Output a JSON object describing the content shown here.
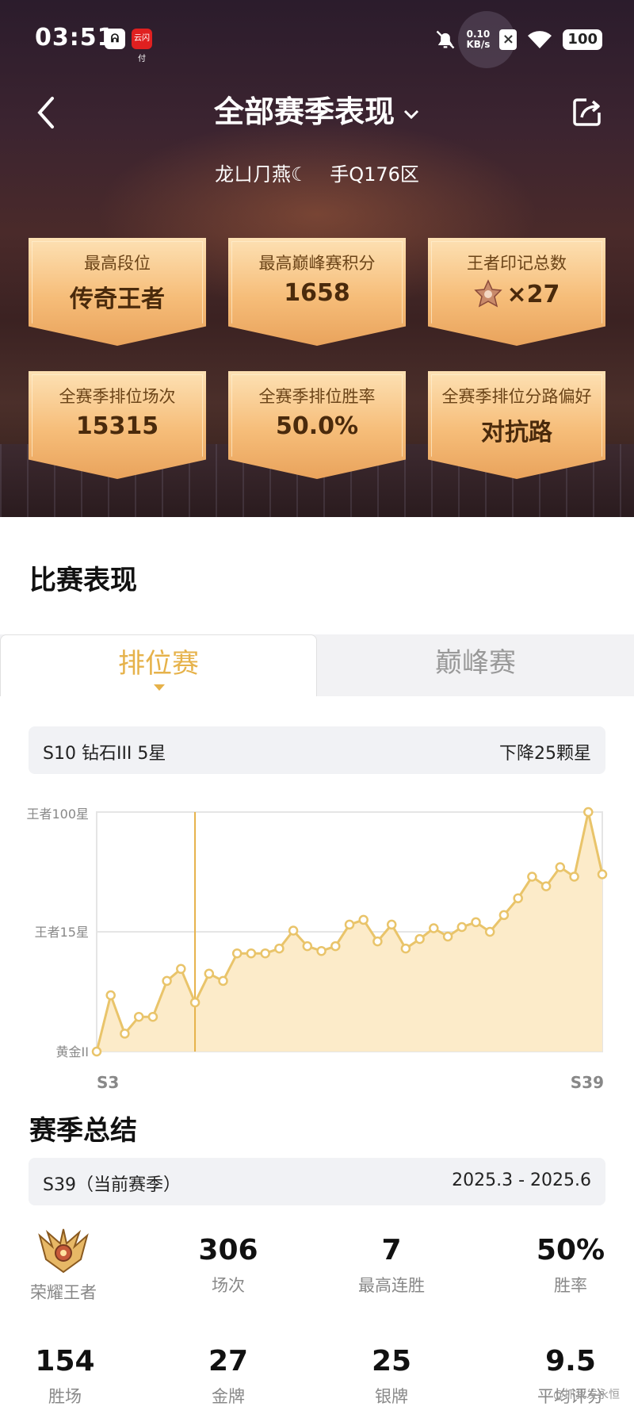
{
  "status_bar": {
    "time": "03:51",
    "pay_icon_text": "云闪付",
    "net_speed_value": "0.10",
    "net_speed_unit": "KB/s",
    "battery": "100"
  },
  "header": {
    "title": "全部赛季表现",
    "player_name": "龙ㄩ⺆燕☾",
    "server": "手Q176区"
  },
  "cards": [
    {
      "label": "最高段位",
      "value": "传奇王者"
    },
    {
      "label": "最高巅峰赛积分",
      "value": "1658"
    },
    {
      "label": "王者印记总数",
      "value": "×27"
    },
    {
      "label": "全赛季排位场次",
      "value": "15315"
    },
    {
      "label": "全赛季排位胜率",
      "value": "50.0%"
    },
    {
      "label": "全赛季排位分路偏好",
      "value": "对抗路"
    }
  ],
  "match_section": {
    "title": "比赛表现",
    "tabs": [
      {
        "label": "排位赛",
        "active": true
      },
      {
        "label": "巅峰赛",
        "active": false
      }
    ],
    "selected_info": {
      "left": "S10 钻石III 5星",
      "right": "下降25颗星"
    }
  },
  "chart_data": {
    "type": "area",
    "y_tick_labels": [
      "王者100星",
      "王者15星",
      "黄金II"
    ],
    "x_start_label": "S3",
    "x_end_label": "S39",
    "highlight_season_index": 7,
    "y_scale_note": "0 = 黄金II, 0.5 = 王者15星, 1 = 王者100星",
    "values": [
      0.0,
      0.235,
      0.075,
      0.145,
      0.145,
      0.295,
      0.345,
      0.205,
      0.325,
      0.295,
      0.41,
      0.41,
      0.41,
      0.43,
      0.505,
      0.44,
      0.42,
      0.44,
      0.53,
      0.55,
      0.46,
      0.53,
      0.43,
      0.47,
      0.515,
      0.48,
      0.52,
      0.54,
      0.5,
      0.57,
      0.64,
      0.73,
      0.69,
      0.77,
      0.73,
      1.0,
      0.74
    ],
    "colors": {
      "line": "#e9c46a",
      "fill": "#fcebc9",
      "highlight": "#e6b24a"
    },
    "grid": true
  },
  "summary": {
    "title": "赛季总结",
    "season_left": "S39（当前赛季）",
    "season_right": "2025.3 - 2025.6",
    "rank_label": "荣耀王者",
    "row1": [
      {
        "value": "306",
        "label": "场次"
      },
      {
        "value": "7",
        "label": "最高连胜"
      },
      {
        "value": "50%",
        "label": "胜率"
      }
    ],
    "row2": [
      {
        "value": "154",
        "label": "胜场"
      },
      {
        "value": "27",
        "label": "金牌"
      },
      {
        "value": "25",
        "label": "银牌"
      },
      {
        "value": "9.5",
        "label": "平均评分"
      }
    ],
    "watermark": "@抓我发永恒"
  }
}
